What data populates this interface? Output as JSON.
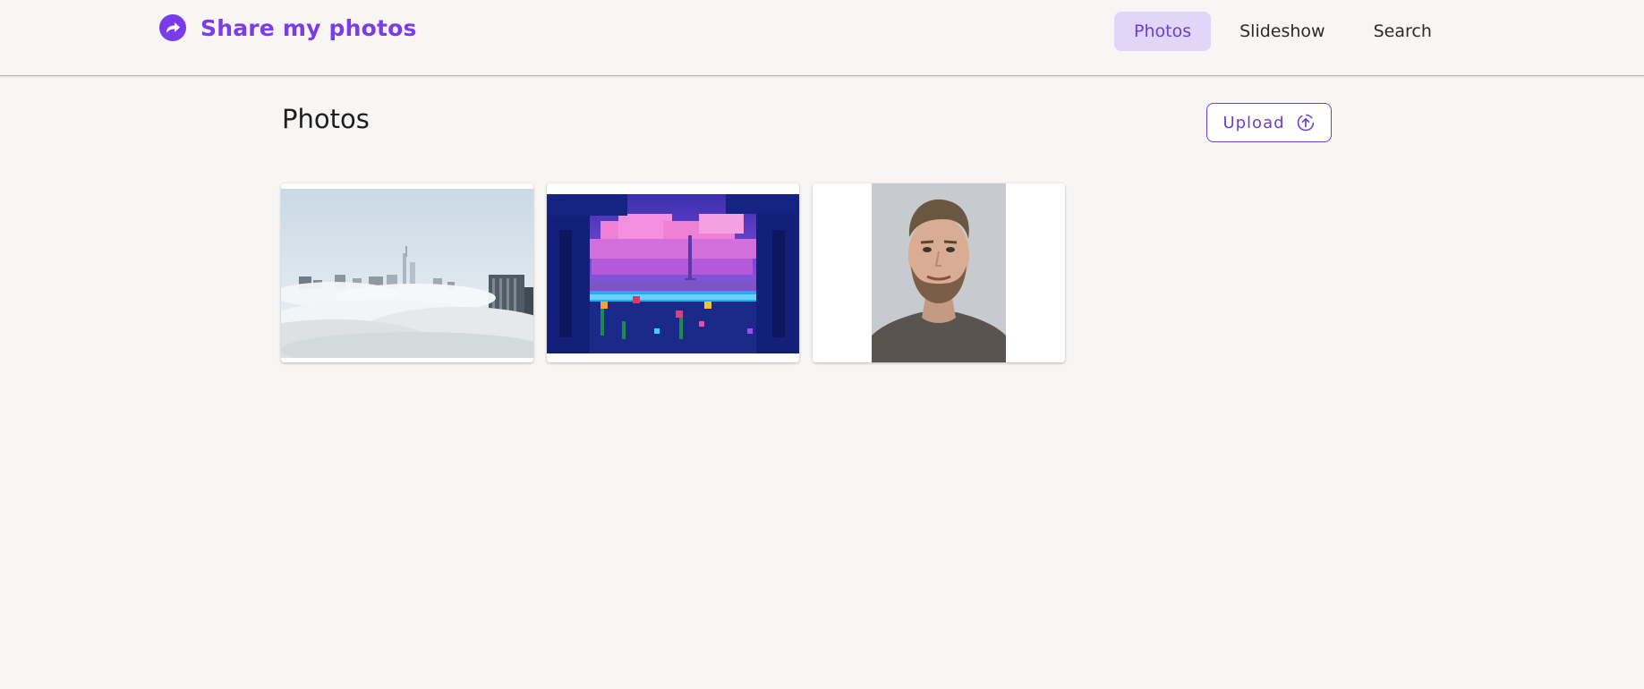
{
  "header": {
    "brand": {
      "title": "Share my photos",
      "icon": "share-arrow-icon",
      "color": "#7a3bea"
    },
    "nav": [
      {
        "label": "Photos",
        "active": true
      },
      {
        "label": "Slideshow",
        "active": false
      },
      {
        "label": "Search",
        "active": false
      }
    ]
  },
  "main": {
    "title": "Photos",
    "upload": {
      "label": "Upload",
      "icon": "upload-circle-icon"
    },
    "photos": [
      {
        "subject": "city skyline above clouds"
      },
      {
        "subject": "pixel art night landscape"
      },
      {
        "subject": "portrait of bearded man"
      }
    ]
  },
  "colors": {
    "accent": "#6a3fd3",
    "active_nav_bg": "#e1d6f7",
    "background": "#f7f6f5"
  }
}
